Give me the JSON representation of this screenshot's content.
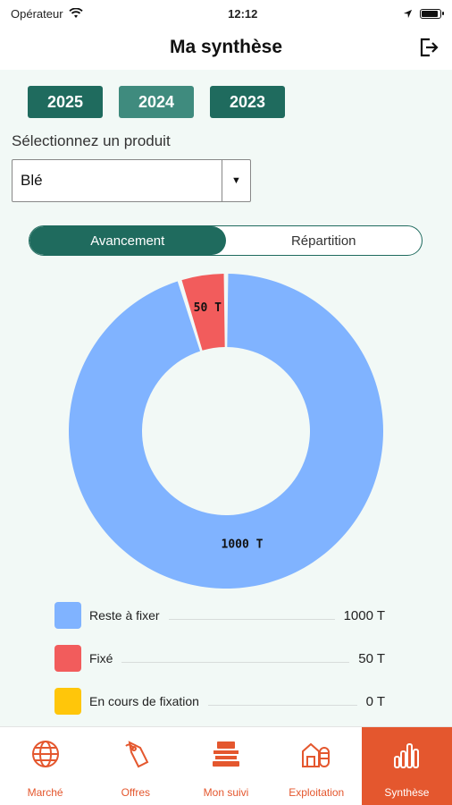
{
  "status": {
    "carrier": "Opérateur",
    "time": "12:12"
  },
  "header": {
    "title": "Ma synthèse"
  },
  "years": [
    {
      "label": "2025",
      "color": "#1f6b5e"
    },
    {
      "label": "2024",
      "color": "#3f8b7e"
    },
    {
      "label": "2023",
      "color": "#1f6b5e"
    }
  ],
  "product": {
    "label": "Sélectionnez un produit",
    "selected": "Blé"
  },
  "segmented": {
    "options": [
      "Avancement",
      "Répartition"
    ],
    "active": "Avancement"
  },
  "chart_data": {
    "type": "pie",
    "labels": [
      "Reste à fixer",
      "Fixé",
      "En cours de fixation"
    ],
    "values": [
      1000,
      50,
      0
    ],
    "unit": "T",
    "colors": [
      "#80b3ff",
      "#f25c5c",
      "#ffc60a"
    ],
    "data_labels": [
      "1000 T",
      "50 T"
    ]
  },
  "legend": [
    {
      "label": "Reste à fixer",
      "value": "1000 T",
      "color": "#80b3ff"
    },
    {
      "label": "Fixé",
      "value": "50 T",
      "color": "#f25c5c"
    },
    {
      "label": "En cours de fixation",
      "value": "0 T",
      "color": "#ffc60a"
    }
  ],
  "tabs": [
    {
      "label": "Marché",
      "icon": "globe-icon"
    },
    {
      "label": "Offres",
      "icon": "price-tag-icon"
    },
    {
      "label": "Mon suivi",
      "icon": "cash-register-icon"
    },
    {
      "label": "Exploitation",
      "icon": "farm-barn-icon"
    },
    {
      "label": "Synthèse",
      "icon": "bar-chart-icon",
      "active": true
    }
  ],
  "accent": "#e4572e"
}
